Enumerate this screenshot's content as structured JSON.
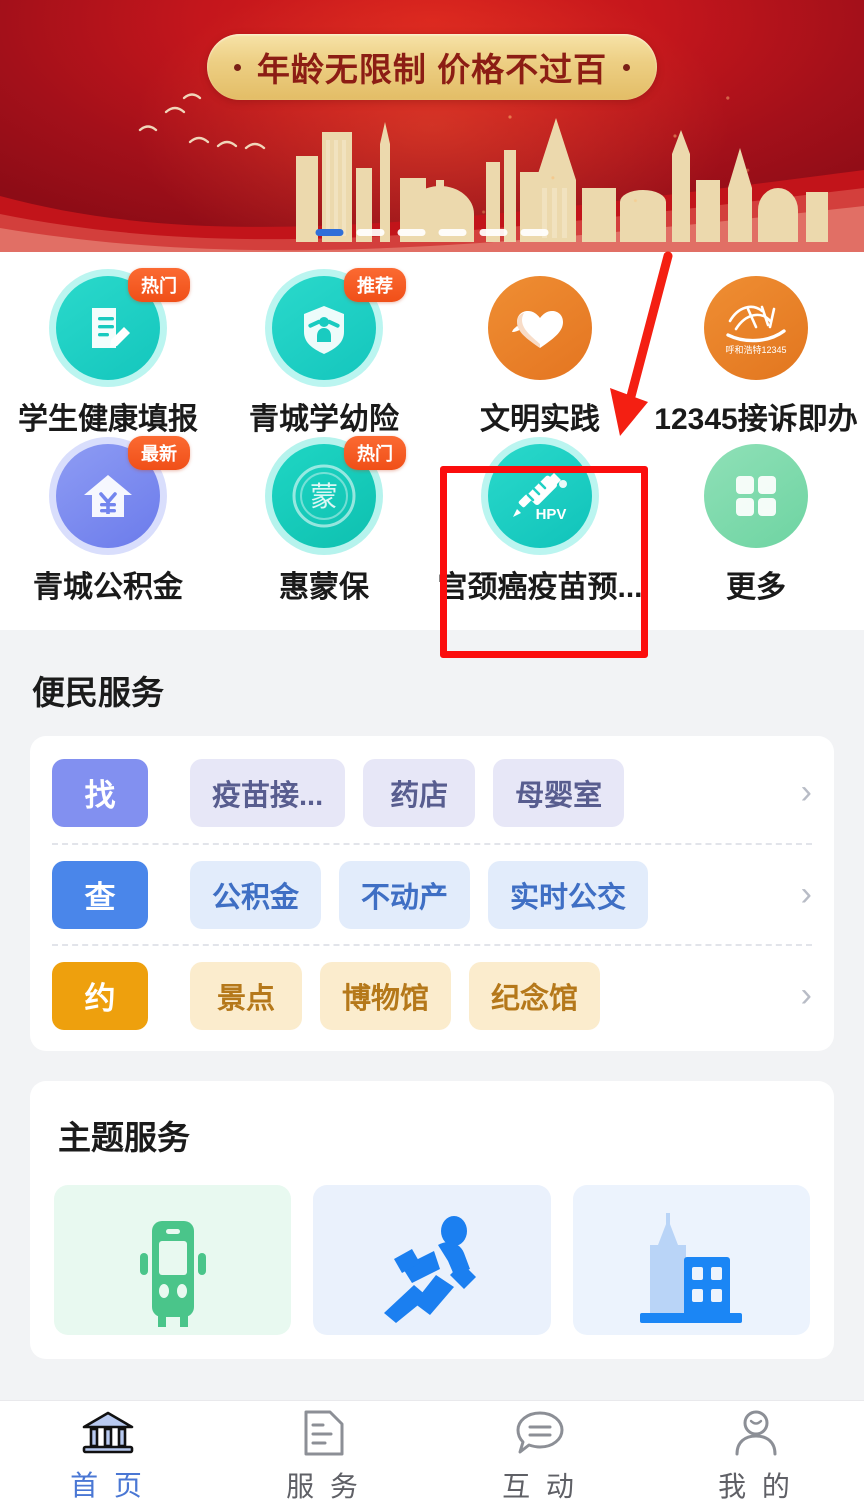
{
  "banner": {
    "headline": "年龄无限制 价格不过百",
    "dot_ornament": "•",
    "carousel": {
      "total": 6,
      "active_index": 0
    }
  },
  "grid": {
    "rows": [
      [
        {
          "label": "学生健康填报",
          "badge": "热门",
          "icon": "document-pencil-icon",
          "color": "#1fcfc2"
        },
        {
          "label": "青城学幼险",
          "badge": "推荐",
          "icon": "shield-person-icon",
          "color": "#1fcfc2"
        },
        {
          "label": "文明实践",
          "badge": "",
          "icon": "heart-hand-icon",
          "color": "#e8802a"
        },
        {
          "label": "12345接诉即办",
          "badge": "",
          "icon": "hotline-logo-icon",
          "color": "#e8802a"
        }
      ],
      [
        {
          "label": "青城公积金",
          "badge": "最新",
          "icon": "house-yuan-icon",
          "color": "#7b8ef0"
        },
        {
          "label": "惠蒙保",
          "badge": "热门",
          "icon": "meng-seal-icon",
          "color": "#16c7b6"
        },
        {
          "label": "宫颈癌疫苗预...",
          "badge": "",
          "icon": "hpv-syringe-icon",
          "color": "#1fcfc2"
        },
        {
          "label": "更多",
          "badge": "",
          "icon": "grid-more-icon",
          "color": "#7fdcad"
        }
      ]
    ]
  },
  "convenience": {
    "title": "便民服务",
    "rows": [
      {
        "tag": "找",
        "tag_color": "#8290f0",
        "chip_bg": "#e7e7f7",
        "chip_text": "#585d8f",
        "chips": [
          "疫苗接...",
          "药店",
          "母婴室"
        ],
        "chevron": "›"
      },
      {
        "tag": "查",
        "tag_color": "#4a86ea",
        "chip_bg": "#e2ecfb",
        "chip_text": "#3f6fc4",
        "chips": [
          "公积金",
          "不动产",
          "实时公交"
        ],
        "chevron": "›"
      },
      {
        "tag": "约",
        "tag_color": "#eea00d",
        "chip_bg": "#fbeccd",
        "chip_text": "#b5781a",
        "chips": [
          "景点",
          "博物馆",
          "纪念馆"
        ],
        "chevron": "›"
      }
    ]
  },
  "theme": {
    "title": "主题服务",
    "items": [
      {
        "icon": "bus-icon",
        "bg": "#e8f9f0",
        "color": "#4ac58a"
      },
      {
        "icon": "runner-icon",
        "bg": "#eaf1fc",
        "color": "#1b7ff0"
      },
      {
        "icon": "buildings-icon",
        "bg": "#ecf3fd",
        "color": "#1b86f5"
      }
    ]
  },
  "tabbar": {
    "items": [
      {
        "label": "首 页",
        "icon": "home-building-icon",
        "active": true
      },
      {
        "label": "服 务",
        "icon": "document-icon",
        "active": false
      },
      {
        "label": "互 动",
        "icon": "chat-bubble-icon",
        "active": false
      },
      {
        "label": "我 的",
        "icon": "person-icon",
        "active": false
      }
    ]
  },
  "annotation": {
    "highlight_target": "宫颈癌疫苗预...",
    "box_color": "#fb0d0d",
    "arrow_color": "#f41f12"
  }
}
